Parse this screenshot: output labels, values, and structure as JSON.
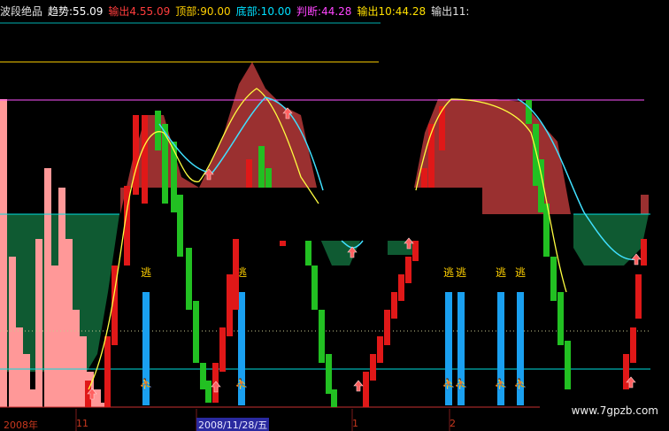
{
  "header": {
    "title": "波段绝品",
    "items": [
      {
        "label": "趋势:",
        "value": "55.09",
        "color": "#ffffff",
        "vcolor": "#ffffff"
      },
      {
        "label": "输出",
        "value": "4.55.09",
        "color": "#ff3d3d",
        "vcolor": "#ff3d3d"
      },
      {
        "label": "顶部:",
        "value": "90.00",
        "color": "#ffd000",
        "vcolor": "#ffd000"
      },
      {
        "label": "底部:",
        "value": "10.00",
        "color": "#00e0ff",
        "vcolor": "#00e0ff"
      },
      {
        "label": "判断:",
        "value": "44.28",
        "color": "#ff44ff",
        "vcolor": "#ff44ff"
      },
      {
        "label": "输出",
        "value": "10:44.28",
        "color": "#ffe000",
        "vcolor": "#ffe000"
      },
      {
        "label": "输出",
        "value": "11:",
        "color": "#e0e0e0",
        "vcolor": "#e0e0e0"
      }
    ]
  },
  "watermark": "www.7gpzb.com",
  "x_labels": [
    {
      "text": "2008年",
      "selected": false
    },
    {
      "text": "11",
      "selected": false
    },
    {
      "text": "2008/11/28/五",
      "selected": true
    },
    {
      "text": "1",
      "selected": false
    },
    {
      "text": "2",
      "selected": false
    }
  ],
  "escape_label": "逃",
  "colors": {
    "up": "#e01818",
    "down": "#22c022",
    "rise_fill": "#9a3030",
    "fall_fill": "#0f5a32",
    "escape_bar": "#1aa0f0",
    "pink": "#ff9898",
    "top_line": "#ffd000",
    "mid_line": "#ff55ff",
    "bottom_line": "#00e0e0"
  },
  "chart_data": {
    "type": "bar",
    "title": "波段绝品",
    "levels": {
      "top": 90,
      "judge": 75,
      "mid": 50,
      "bottom": 10
    },
    "ylim": [
      0,
      100
    ],
    "escape_signals_at": [
      8,
      14,
      26,
      27,
      30,
      31
    ],
    "candles": [
      {
        "x": 6,
        "open": 20,
        "close": 4,
        "dir": "down"
      },
      {
        "x": 7,
        "open": 4,
        "close": 30,
        "dir": "up"
      },
      {
        "x": 8,
        "open": 30,
        "close": 58,
        "dir": "up"
      },
      {
        "x": 9,
        "open": 58,
        "close": 82,
        "dir": "up"
      },
      {
        "x": 10,
        "open": 82,
        "close": 62,
        "dir": "down"
      },
      {
        "x": 11,
        "open": 62,
        "close": 38,
        "dir": "down"
      },
      {
        "x": 12,
        "open": 38,
        "close": 18,
        "dir": "down"
      },
      {
        "x": 13,
        "open": 18,
        "close": 42,
        "dir": "up"
      },
      {
        "x": 14,
        "open": 42,
        "close": 66,
        "dir": "up"
      },
      {
        "x": 15,
        "open": 66,
        "close": 80,
        "dir": "up"
      },
      {
        "x": 16,
        "open": 80,
        "close": 55,
        "dir": "down"
      },
      {
        "x": 17,
        "open": 55,
        "close": 30,
        "dir": "down"
      },
      {
        "x": 18,
        "open": 30,
        "close": 4,
        "dir": "down"
      },
      {
        "x": 19,
        "open": 4,
        "close": 32,
        "dir": "up"
      },
      {
        "x": 20,
        "open": 32,
        "close": 58,
        "dir": "up"
      },
      {
        "x": 21,
        "open": 58,
        "close": 78,
        "dir": "up"
      },
      {
        "x": 22,
        "open": 78,
        "close": 82,
        "dir": "up"
      },
      {
        "x": 24,
        "open": 66,
        "close": 70,
        "dir": "up"
      },
      {
        "x": 25,
        "open": 70,
        "close": 84,
        "dir": "up"
      },
      {
        "x": 26,
        "open": 84,
        "close": 88,
        "dir": "up"
      },
      {
        "x": 27,
        "open": 88,
        "close": 76,
        "dir": "down"
      },
      {
        "x": 28,
        "open": 76,
        "close": 60,
        "dir": "down"
      },
      {
        "x": 29,
        "open": 60,
        "close": 44,
        "dir": "down"
      },
      {
        "x": 30,
        "open": 44,
        "close": 24,
        "dir": "down"
      },
      {
        "x": 31,
        "open": 24,
        "close": 10,
        "dir": "down"
      },
      {
        "x": 32,
        "open": 10,
        "close": 26,
        "dir": "up"
      },
      {
        "x": 33,
        "open": 26,
        "close": 46,
        "dir": "up"
      }
    ]
  }
}
